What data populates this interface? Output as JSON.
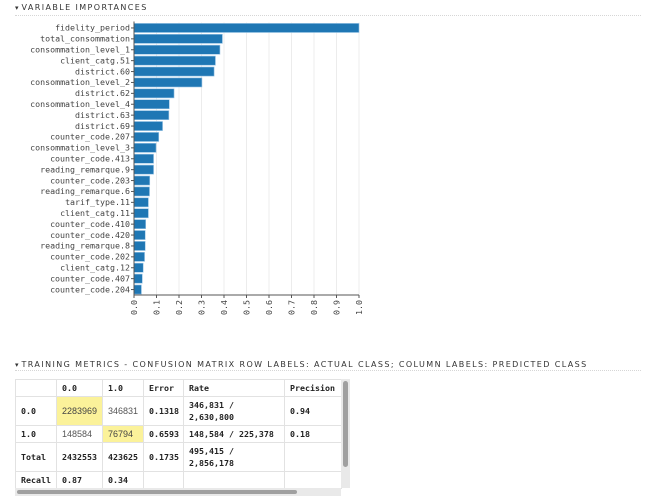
{
  "sections": {
    "variable_importances": {
      "caret": "▾",
      "title": "VARIABLE IMPORTANCES"
    },
    "training_metrics": {
      "caret": "▾",
      "title": "TRAINING METRICS - CONFUSION MATRIX ROW LABELS: ACTUAL CLASS; COLUMN LABELS: PREDICTED CLASS"
    }
  },
  "colors": {
    "bar": "#1f77b4",
    "highlight": "#fbf29a"
  },
  "chart_data": {
    "type": "bar",
    "orientation": "horizontal",
    "title": "Variable Importances",
    "xlabel": "",
    "ylabel": "",
    "categories": [
      "fidelity_period",
      "total_consommation",
      "consommation_level_1",
      "client_catg.51",
      "district.60",
      "consommation_level_2",
      "district.62",
      "consommation_level_4",
      "district.63",
      "district.69",
      "counter_code.207",
      "consommation_level_3",
      "counter_code.413",
      "reading_remarque.9",
      "counter_code.203",
      "reading_remarque.6",
      "tarif_type.11",
      "client_catg.11",
      "counter_code.410",
      "counter_code.420",
      "reading_remarque.8",
      "counter_code.202",
      "client_catg.12",
      "counter_code.407",
      "counter_code.204"
    ],
    "values": [
      1.0,
      0.393,
      0.382,
      0.362,
      0.356,
      0.302,
      0.178,
      0.157,
      0.155,
      0.127,
      0.11,
      0.098,
      0.087,
      0.087,
      0.07,
      0.069,
      0.064,
      0.064,
      0.052,
      0.05,
      0.05,
      0.047,
      0.041,
      0.037,
      0.033
    ],
    "xlim": [
      0,
      1.0
    ],
    "xticks": [
      "0.0",
      "0.1",
      "0.2",
      "0.3",
      "0.4",
      "0.5",
      "0.6",
      "0.7",
      "0.8",
      "0.9",
      "1.0"
    ],
    "grid": true,
    "legend": "none"
  },
  "confusion_matrix": {
    "headers": [
      "",
      "0.0",
      "1.0",
      "Error",
      "Rate",
      "Precision"
    ],
    "rows": [
      {
        "label": "0.0",
        "c0": "2283969",
        "c1": "346831",
        "error": "0.1318",
        "rate": "346,831 / 2,630,800",
        "precision": "0.94"
      },
      {
        "label": "1.0",
        "c0": "148584",
        "c1": "76794",
        "error": "0.6593",
        "rate": "148,584 / 225,378",
        "precision": "0.18"
      },
      {
        "label": "Total",
        "c0": "2432553",
        "c1": "423625",
        "error": "0.1735",
        "rate": "495,415 / 2,856,178",
        "precision": ""
      },
      {
        "label": "Recall",
        "c0": "0.87",
        "c1": "0.34",
        "error": "",
        "rate": "",
        "precision": ""
      }
    ]
  }
}
